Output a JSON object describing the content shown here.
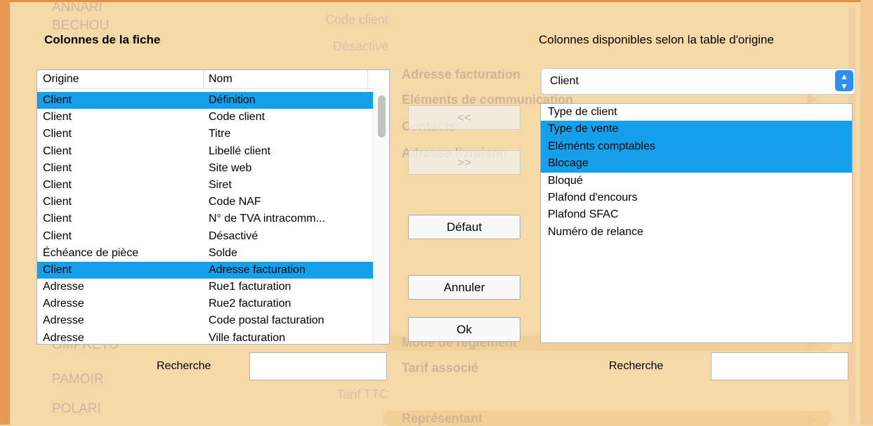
{
  "background": {
    "list_items": [
      "ANNARI",
      "BECHOU",
      "OMPRETU",
      "PAMOIR",
      "POLARI"
    ],
    "field_labels": [
      "Code client",
      "Désactivé",
      "Tarif TTC"
    ],
    "section_headers": [
      "Adresse facturation",
      "Eléments de communication",
      "Contacts",
      "Adresse livraison",
      "Mode de règlement",
      "Tarif associé",
      "Représentant"
    ]
  },
  "sheet": {
    "left_title": "Colonnes de la fiche",
    "right_title": "Colonnes disponibles selon la table d'origine",
    "table": {
      "headers": [
        "Origine",
        "Nom"
      ],
      "rows": [
        {
          "origine": "Client",
          "nom": "Définition",
          "selected": true
        },
        {
          "origine": "Client",
          "nom": "Code client",
          "selected": false
        },
        {
          "origine": "Client",
          "nom": "Titre",
          "selected": false
        },
        {
          "origine": "Client",
          "nom": "Libellé client",
          "selected": false
        },
        {
          "origine": "Client",
          "nom": "Site web",
          "selected": false
        },
        {
          "origine": "Client",
          "nom": "Siret",
          "selected": false
        },
        {
          "origine": "Client",
          "nom": "Code NAF",
          "selected": false
        },
        {
          "origine": "Client",
          "nom": "N° de TVA intracomm...",
          "selected": false
        },
        {
          "origine": "Client",
          "nom": "Désactivé",
          "selected": false
        },
        {
          "origine": "Échéance de pièce",
          "nom": "Solde",
          "selected": false
        },
        {
          "origine": "Client",
          "nom": "Adresse facturation",
          "selected": true
        },
        {
          "origine": "Adresse",
          "nom": "Rue1 facturation",
          "selected": false
        },
        {
          "origine": "Adresse",
          "nom": "Rue2 facturation",
          "selected": false
        },
        {
          "origine": "Adresse",
          "nom": "Code postal facturation",
          "selected": false
        },
        {
          "origine": "Adresse",
          "nom": "Ville facturation",
          "selected": false
        }
      ]
    },
    "buttons": {
      "remove": "<<",
      "add": ">>",
      "default": "Défaut",
      "cancel": "Annuler",
      "ok": "Ok"
    },
    "origin_select": {
      "value": "Client",
      "arrow_up": "▲",
      "arrow_down": "▼"
    },
    "available_columns": [
      {
        "label": "Type de client",
        "selected": false
      },
      {
        "label": "Type de vente",
        "selected": true
      },
      {
        "label": "Eléménts comptables",
        "selected": true
      },
      {
        "label": "Blocage",
        "selected": true
      },
      {
        "label": "Bloqué",
        "selected": false
      },
      {
        "label": "Plafond d'encours",
        "selected": false
      },
      {
        "label": "Plafond SFAC",
        "selected": false
      },
      {
        "label": "Numéro de relance",
        "selected": false
      }
    ],
    "search_label": "Recherche",
    "search_left_value": "",
    "search_right_value": "",
    "colors": {
      "selection": "#14a0ea",
      "accent": "#e98c3c",
      "select_button": "#2e8ef4"
    }
  }
}
